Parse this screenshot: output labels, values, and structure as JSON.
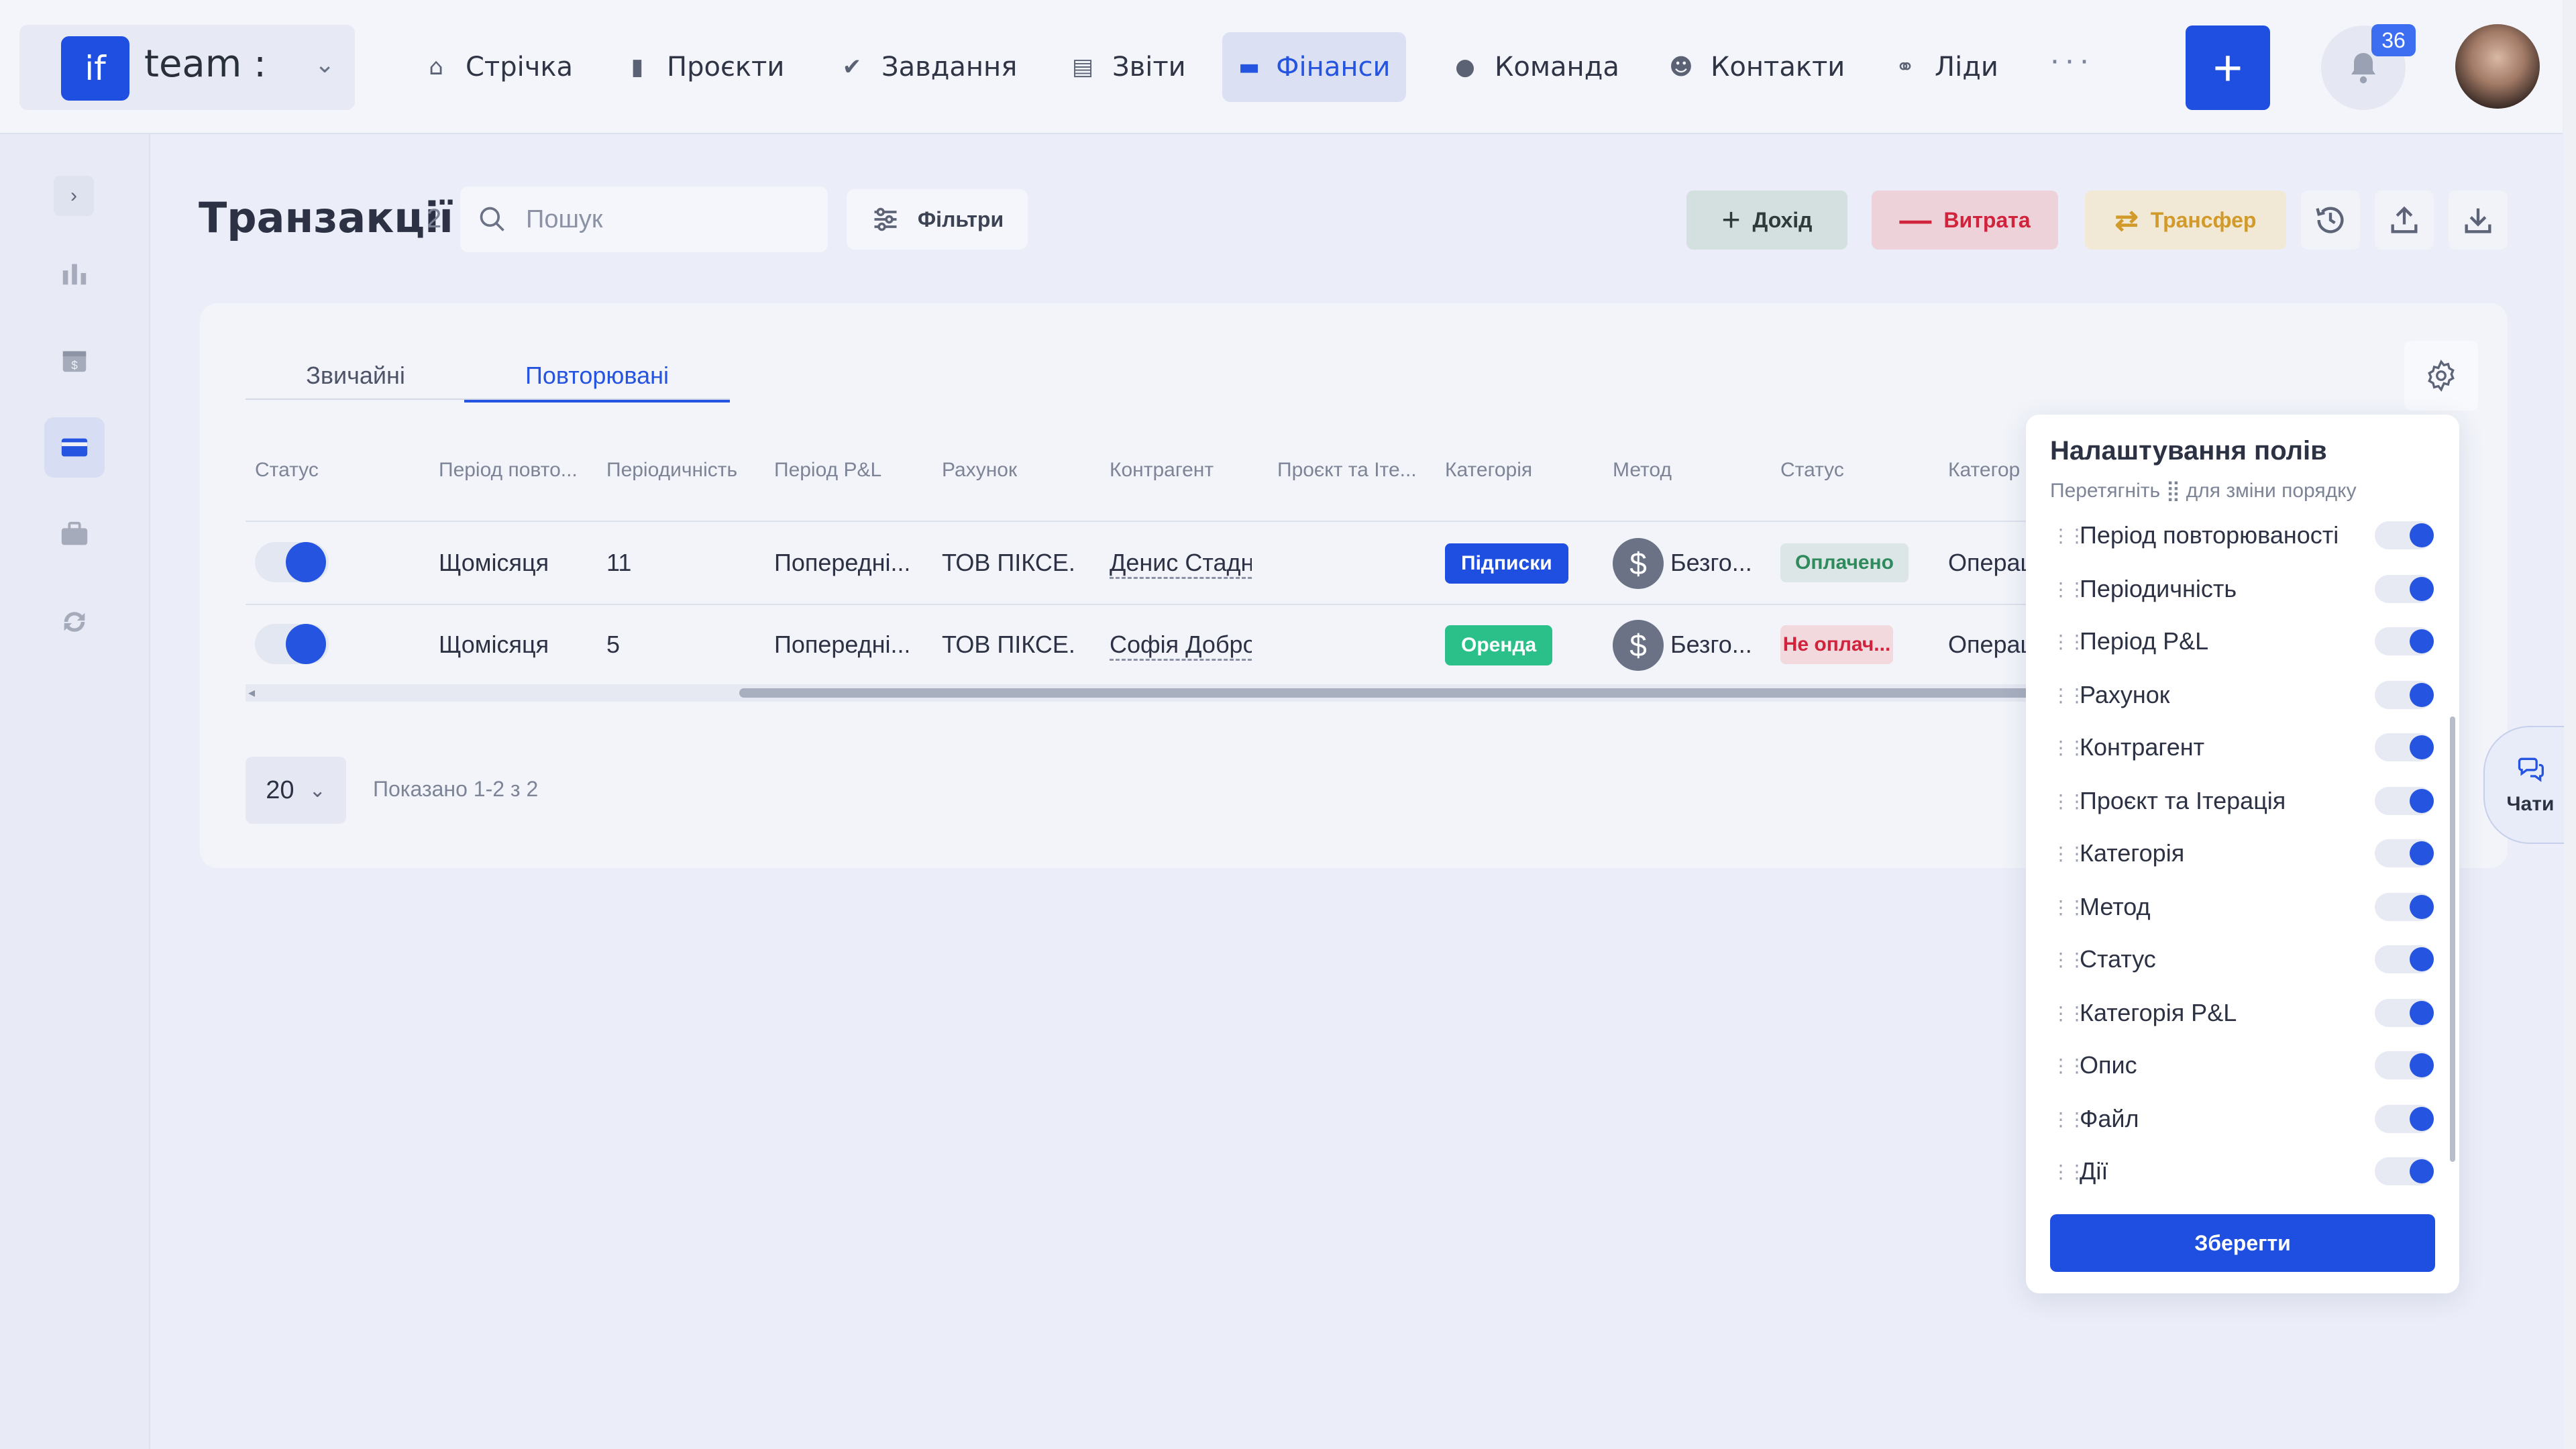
{
  "brand": {
    "logo": "if",
    "name": "team :"
  },
  "nav": [
    {
      "label": "Стрічка",
      "icon": "home-icon"
    },
    {
      "label": "Проєкти",
      "icon": "document-icon"
    },
    {
      "label": "Завдання",
      "icon": "check-circle-icon"
    },
    {
      "label": "Звіти",
      "icon": "report-icon"
    },
    {
      "label": "Фінанси",
      "icon": "wallet-icon",
      "active": true
    },
    {
      "label": "Команда",
      "icon": "person-icon"
    },
    {
      "label": "Контакти",
      "icon": "contacts-icon"
    },
    {
      "label": "Ліди",
      "icon": "leads-icon"
    }
  ],
  "nav_more": "···",
  "notifications": {
    "count": "36"
  },
  "page": {
    "title": "Транзакції",
    "count": "2"
  },
  "search": {
    "placeholder": "Пошук"
  },
  "filters_label": "Фільтри",
  "actions": {
    "income": "Дохід",
    "expense": "Витрата",
    "transfer": "Трансфер"
  },
  "tabs": [
    {
      "label": "Звичайні"
    },
    {
      "label": "Повторювані",
      "active": true
    }
  ],
  "columns": [
    "Статус",
    "Період повто...",
    "Періодичність",
    "Період P&L",
    "Рахунок",
    "Контрагент",
    "Проєкт та Іте...",
    "Категорія",
    "Метод",
    "Статус",
    "Категор"
  ],
  "rows": [
    {
      "period": "Щомісяця",
      "frequency": "11",
      "pl_period": "Попередні...",
      "account": "ТОВ ПІКСЕ...",
      "counterparty": "Денис Стадн",
      "category": "Підписки",
      "method": "Безго...",
      "status": "Оплачено",
      "pl_category": "Операц"
    },
    {
      "period": "Щомісяця",
      "frequency": "5",
      "pl_period": "Попередні...",
      "account": "ТОВ ПІКСЕ...",
      "counterparty": "Софія Добро",
      "category": "Оренда",
      "method": "Безго...",
      "status": "Не оплач...",
      "pl_category": "Операц"
    }
  ],
  "pagination": {
    "per_page": "20",
    "shown": "Показано 1-2 з 2"
  },
  "field_settings": {
    "title": "Налаштування полів",
    "subtitle": "Перетягніть ⣿ для зміни порядку",
    "fields": [
      "Період повторюваності",
      "Періодичність",
      "Період P&L",
      "Рахунок",
      "Контрагент",
      "Проєкт та Ітерація",
      "Категорія",
      "Метод",
      "Статус",
      "Категорія P&L",
      "Опис",
      "Файл",
      "Дії"
    ],
    "save": "Зберегти"
  },
  "chat": {
    "label": "Чати"
  },
  "colors": {
    "primary": "#1f4fe0",
    "subscriptions_tag": "#1f4fe0",
    "rent_tag": "#2bbf8a",
    "paid_bg": "#dce6e6",
    "unpaid_bg": "#f1d9de"
  }
}
